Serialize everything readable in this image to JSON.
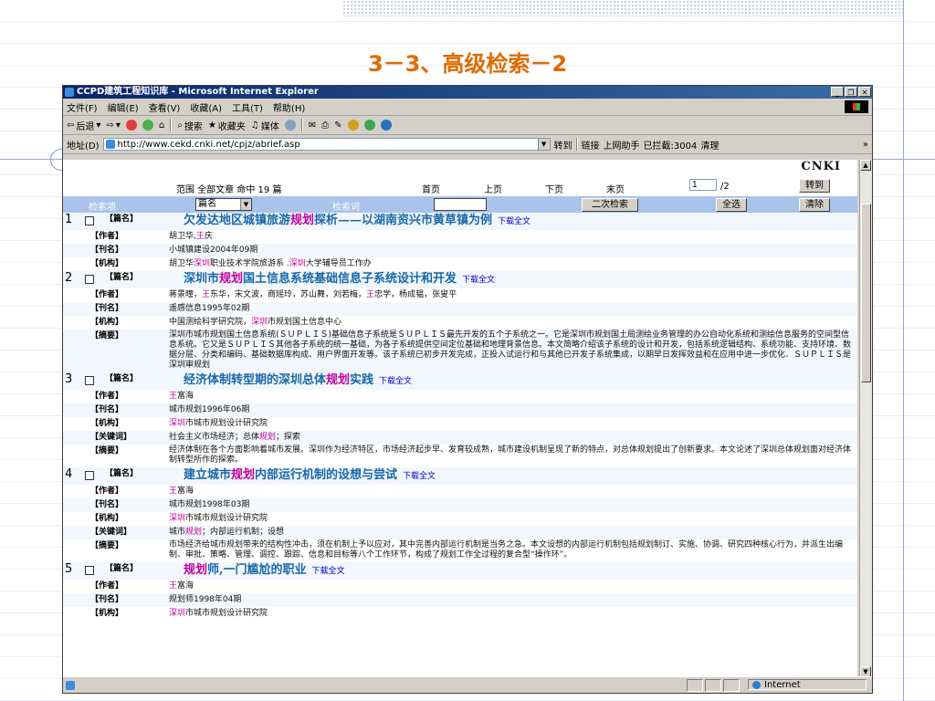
{
  "slide_title": "3－3、高级检索－2",
  "window": {
    "title": "CCPD建筑工程知识库 - Microsoft Internet Explorer",
    "buttons": [
      "_",
      "❐",
      "✕"
    ]
  },
  "menu": [
    "文件(F)",
    "编辑(E)",
    "查看(V)",
    "收藏(A)",
    "工具(T)",
    "帮助(H)"
  ],
  "toolbar": {
    "back": "后退",
    "search": "搜索",
    "favorites": "收藏夹",
    "media": "媒体"
  },
  "address": {
    "label": "地址(D)",
    "url": "http://www.cekd.cnki.net/cpjz/abrief.asp",
    "go": "转到",
    "links": "链接",
    "helper": "上网助手",
    "blocked": "已拦截:3004",
    "clean": "清理",
    "more": "»"
  },
  "brand": "CNKI",
  "pager": {
    "summary": "范围 全部文章 命中 19 篇",
    "first": "首页",
    "prev": "上页",
    "next": "下页",
    "last": "末页",
    "page_value": "1",
    "page_total": "/2",
    "goto": "转到"
  },
  "search": {
    "field_header": "检索项",
    "field_value": "篇名",
    "keyword_header": "检索词",
    "secondary": "二次检索",
    "select_all": "全选",
    "clear": "清除"
  },
  "download_label": "下载全文",
  "records": [
    {
      "num": "1",
      "title_parts": [
        "欠发达地区城镇旅游",
        "规划",
        "探析——以湖南资兴市黄草镇为例"
      ],
      "rows": [
        {
          "label": "【作者】",
          "parts": [
            "胡卫华,",
            "王",
            "庆"
          ]
        },
        {
          "label": "【刊名】",
          "parts": [
            "小城镇建设2004年09期",
            "",
            ""
          ]
        },
        {
          "label": "【机构】",
          "parts": [
            "胡卫华",
            "深圳",
            "职业技术学院旅游系 .",
            "深圳",
            "大学辅导员工作办"
          ]
        }
      ]
    },
    {
      "num": "2",
      "title_parts": [
        "深圳市",
        "规划",
        "国土信息系统基础信息子系统设计和开发"
      ],
      "rows": [
        {
          "label": "【作者】",
          "parts": [
            "蒋景曈，",
            "王",
            "东华，宋文波，商瑶玲，苏山舞，刘若梅，",
            "王",
            "忠学，杨成韫，张叟平"
          ]
        },
        {
          "label": "【刊名】",
          "parts": [
            "遥感信息1995年02期"
          ]
        },
        {
          "label": "【机构】",
          "parts": [
            "中国测绘科学研究院，",
            "深圳",
            "市规划国土信息中心"
          ]
        },
        {
          "label": "【摘要】",
          "abstract": true,
          "parts": [
            "深圳市城市规划国土信息系统(ＳＵＰＬＩＳ)基础信息子系统是ＳＵＰＬＩＳ最先开发的五个子系统之一。它是深圳市规划国土局测绘业务管理的办公自动化系统和测绘信息服务的空间型信息系统。它又是ＳＵＰＬＩＳ其他各子系统的统一基础，为各子系统提供空间定位基础和地理背景信息。本文简略介绍该子系统的设计和开发，包括系统逻辑结构、系统功能、支持环境、数据分层、分类和编码、基础数据库构成、用户界面开发等。该子系统已初步开发完成，正投入试运行和与其他已开发子系统集成，以期早日发挥效益和在应用中进一步优化．ＳＵＰＬＩＳ是深圳审规划"
          ]
        }
      ]
    },
    {
      "num": "3",
      "title_parts": [
        "经济体制转型期的深圳总体",
        "规划",
        "实践"
      ],
      "rows": [
        {
          "label": "【作者】",
          "parts": [
            "",
            "王",
            "富海"
          ]
        },
        {
          "label": "【刊名】",
          "parts": [
            "城市规划1996年06期"
          ]
        },
        {
          "label": "【机构】",
          "parts": [
            "",
            "深圳",
            "市城市规划设计研究院"
          ]
        },
        {
          "label": "【关键词】",
          "parts": [
            "社会主义市场经济；总体",
            "规划",
            "；探索"
          ]
        },
        {
          "label": "【摘要】",
          "abstract": true,
          "parts": [
            "经济体制在各个方面影响着城市发展。深圳作为经济特区，市场经济起步早、发育较成熟，城市建设机制呈现了新的特点，对总体规划提出了创新要求。本文论述了深圳总体规划面对经济体制转型所作的探索。"
          ]
        }
      ]
    },
    {
      "num": "4",
      "title_parts": [
        "建立城市",
        "规划",
        "内部运行机制的设想与尝试"
      ],
      "rows": [
        {
          "label": "【作者】",
          "parts": [
            "",
            "王",
            "富海"
          ]
        },
        {
          "label": "【刊名】",
          "parts": [
            "城市规划1998年03期"
          ]
        },
        {
          "label": "【机构】",
          "parts": [
            "",
            "深圳",
            "市城市规划设计研究院"
          ]
        },
        {
          "label": "【关键词】",
          "parts": [
            "城市",
            "规划",
            "；内部运行机制；设想"
          ]
        },
        {
          "label": "【摘要】",
          "abstract": true,
          "parts": [
            "市场经济给城市规划带来的结构性冲击，须在机制上予以应对，其中完善内部运行机制是当务之急。本文设想的内部运行机制包括规划制订、实施、协调、研究四种核心行为，并派生出编制、审批、策略、管理、调控、跟踪、信息和目标等八个工作环节，构成了规划工作全过程的复合型“操作环”。"
          ]
        }
      ]
    },
    {
      "num": "5",
      "title_parts": [
        "",
        "规划",
        "师,一门尴尬的职业"
      ],
      "rows": [
        {
          "label": "【作者】",
          "parts": [
            "",
            "王",
            "富海"
          ]
        },
        {
          "label": "【刊名】",
          "parts": [
            "规划师1998年04期"
          ]
        },
        {
          "label": "【机构】",
          "parts": [
            "",
            "深圳",
            "市城市规划设计研究院"
          ]
        }
      ]
    }
  ],
  "status": {
    "zone": "Internet"
  }
}
